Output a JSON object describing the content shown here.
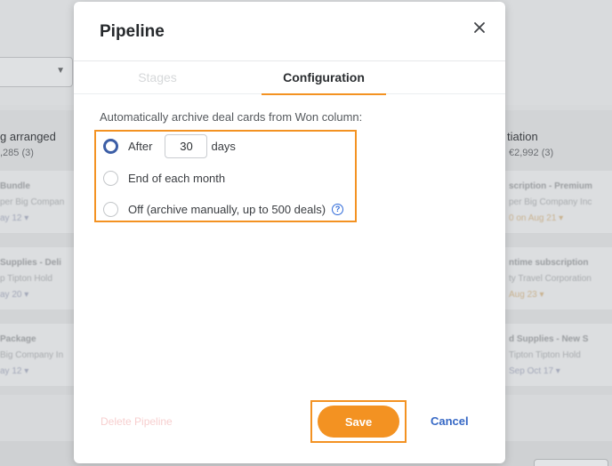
{
  "background": {
    "select_caret": "▼",
    "left_column": {
      "title": "g arranged",
      "subtitle": ",285 (3)",
      "cards": [
        {
          "title": "Bundle",
          "org": "per Big Compan",
          "meta": "ay 12 ▾"
        },
        {
          "title": "Supplies - Deli",
          "org": "p Tipton Hold",
          "meta": "ay 20 ▾"
        },
        {
          "title": "Package",
          "org": "Big Company In",
          "meta": "ay 12 ▾"
        }
      ]
    },
    "right_column": {
      "title": "tiation",
      "subtitle": "€2,992 (3)",
      "cards": [
        {
          "title": "scription - Premium",
          "org": "per Big Company Inc",
          "meta": "0 on Aug 21 ▾"
        },
        {
          "title": "ntime subscription",
          "org": "ty Travel Corporation",
          "meta": "Aug 23 ▾"
        },
        {
          "title": "d Supplies - New S",
          "org": "Tipton Tipton Hold",
          "meta": "Sep Oct 17 ▾"
        }
      ]
    }
  },
  "modal": {
    "title": "Pipeline",
    "close_icon": "close-icon",
    "tabs": [
      {
        "label": "Stages",
        "active": false
      },
      {
        "label": "Configuration",
        "active": true
      }
    ],
    "description": "Automatically archive deal cards from Won column:",
    "options": {
      "after_label": "After",
      "after_days_value": "30",
      "after_days_unit": "days",
      "month_label": "End of each month",
      "off_label": "Off (archive manually, up to 500 deals)",
      "help_glyph": "?",
      "selected": "after"
    },
    "footer": {
      "delete_label": "Delete Pipeline",
      "save_label": "Save",
      "cancel_label": "Cancel"
    }
  },
  "colors": {
    "accent_orange": "#f39222",
    "link_blue": "#3668c5",
    "radio_selected": "#3c5ea6"
  }
}
